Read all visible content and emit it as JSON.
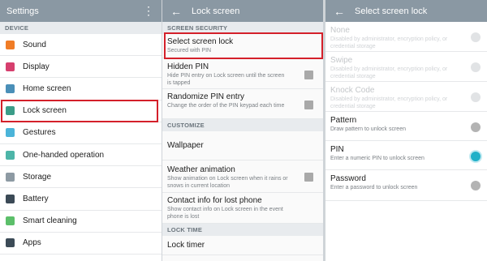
{
  "settings": {
    "title": "Settings",
    "menu_icon": "overflow-menu-icon",
    "section": "DEVICE",
    "items": [
      {
        "label": "Sound",
        "icon": "sound-icon",
        "color": "#f07c26"
      },
      {
        "label": "Display",
        "icon": "display-icon",
        "color": "#d63f6e"
      },
      {
        "label": "Home screen",
        "icon": "home-screen-icon",
        "color": "#4a8fb8"
      },
      {
        "label": "Lock screen",
        "icon": "lock-screen-icon",
        "color": "#3b9c88"
      },
      {
        "label": "Gestures",
        "icon": "gestures-icon",
        "color": "#4bb4d9"
      },
      {
        "label": "One-handed operation",
        "icon": "one-handed-icon",
        "color": "#4db5a8"
      },
      {
        "label": "Storage",
        "icon": "storage-icon",
        "color": "#8d9aa3"
      },
      {
        "label": "Battery",
        "icon": "battery-icon",
        "color": "#3b4a56"
      },
      {
        "label": "Smart cleaning",
        "icon": "smart-cleaning-icon",
        "color": "#5cbf6a"
      },
      {
        "label": "Apps",
        "icon": "apps-icon",
        "color": "#3c4b57"
      }
    ]
  },
  "lock": {
    "title": "Lock screen",
    "back_icon": "back-arrow-icon",
    "sec_security": "SCREEN SECURITY",
    "select": {
      "title": "Select screen lock",
      "sub": "Secured with PIN"
    },
    "hidden_pin": {
      "title": "Hidden PIN",
      "sub": "Hide PIN entry on Lock screen until the screen is tapped"
    },
    "randomize": {
      "title": "Randomize PIN entry",
      "sub": "Change the order of the PIN keypad each time"
    },
    "sec_customize": "CUSTOMIZE",
    "wallpaper": {
      "title": "Wallpaper"
    },
    "weather": {
      "title": "Weather animation",
      "sub": "Show animation on Lock screen when it rains or snows in current location"
    },
    "contact": {
      "title": "Contact info for lost phone",
      "sub": "Show contact info on Lock screen in the event phone is lost"
    },
    "sec_locktime": "LOCK TIME",
    "locktimer": {
      "title": "Lock timer"
    }
  },
  "select": {
    "title": "Select screen lock",
    "back_icon": "back-arrow-icon",
    "options": [
      {
        "title": "None",
        "sub": "Disabled by administrator, encryption policy, or credential storage",
        "disabled": true,
        "selected": false
      },
      {
        "title": "Swipe",
        "sub": "Disabled by administrator, encryption policy, or credential storage",
        "disabled": true,
        "selected": false
      },
      {
        "title": "Knock Code",
        "sub": "Disabled by administrator, encryption policy, or credential storage",
        "disabled": true,
        "selected": false
      },
      {
        "title": "Pattern",
        "sub": "Draw pattern to unlock screen",
        "disabled": false,
        "selected": false
      },
      {
        "title": "PIN",
        "sub": "Enter a numeric PIN to unlock screen",
        "disabled": false,
        "selected": true
      },
      {
        "title": "Password",
        "sub": "Enter a password to unlock screen",
        "disabled": false,
        "selected": false
      }
    ],
    "selected_color": "#20b0c8"
  },
  "highlight_color": "#d4202a"
}
